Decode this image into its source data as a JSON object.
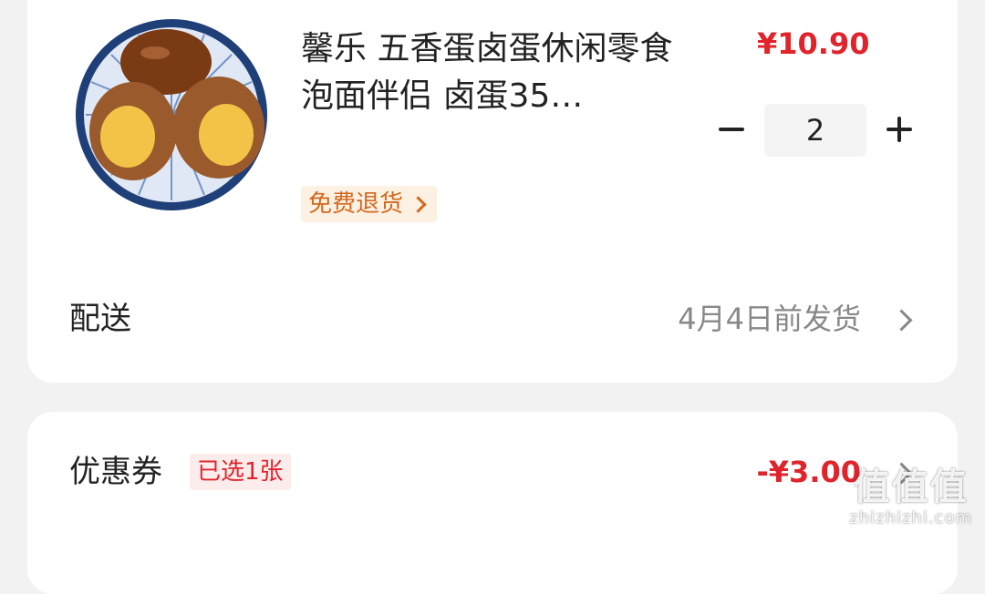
{
  "product": {
    "title": "馨乐 五香蛋卤蛋休闲零食泡面伴侣 卤蛋35…",
    "price": "¥10.90",
    "quantity": "2",
    "return_badge": "免费退货"
  },
  "shipping": {
    "label": "配送",
    "value": "4月4日前发货"
  },
  "coupon": {
    "label": "优惠券",
    "badge": "已选1张",
    "value": "-¥3.00"
  },
  "watermark": {
    "main": "值值值",
    "sub": "zhizhizhi.com"
  },
  "colors": {
    "price_red": "#e0242c",
    "badge_orange": "#d2691e",
    "muted_gray": "#888888"
  }
}
